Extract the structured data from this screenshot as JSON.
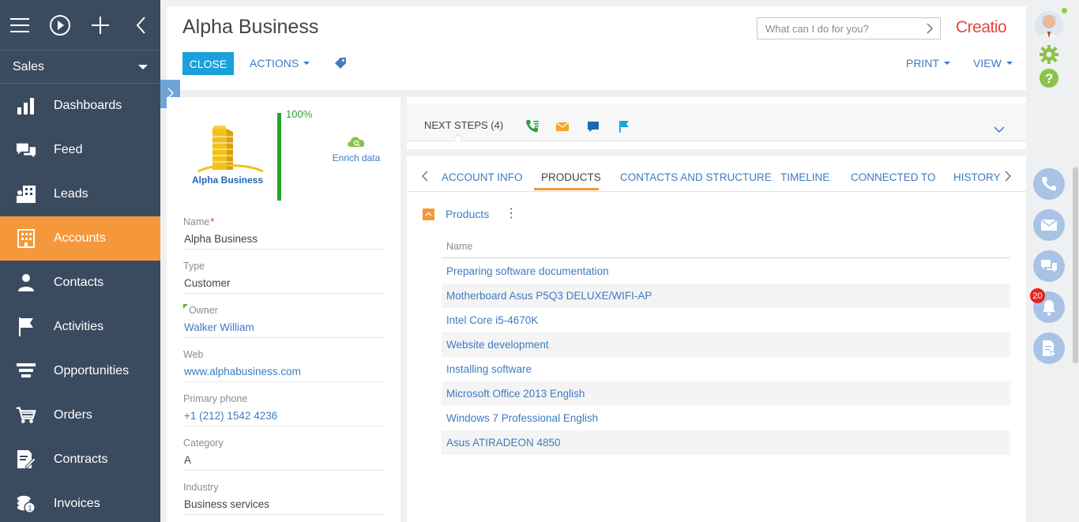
{
  "sidebar": {
    "workspace": "Sales",
    "items": [
      {
        "label": "Dashboards",
        "icon": "dashboards-icon"
      },
      {
        "label": "Feed",
        "icon": "feed-icon"
      },
      {
        "label": "Leads",
        "icon": "leads-icon"
      },
      {
        "label": "Accounts",
        "icon": "accounts-icon"
      },
      {
        "label": "Contacts",
        "icon": "contacts-icon"
      },
      {
        "label": "Activities",
        "icon": "activities-icon"
      },
      {
        "label": "Opportunities",
        "icon": "opportunities-icon"
      },
      {
        "label": "Orders",
        "icon": "orders-icon"
      },
      {
        "label": "Contracts",
        "icon": "contracts-icon"
      },
      {
        "label": "Invoices",
        "icon": "invoices-icon"
      }
    ],
    "active_item": "Accounts"
  },
  "header": {
    "title": "Alpha Business",
    "search_placeholder": "What can I do for you?",
    "logo": "Creatio",
    "close_label": "CLOSE",
    "actions_label": "ACTIONS",
    "print_label": "PRINT",
    "view_label": "VIEW"
  },
  "profile": {
    "company_logo_text": "Alpha Business",
    "completeness": "100%",
    "completeness_value": 1.0,
    "enrich_label": "Enrich data",
    "fields": [
      {
        "label": "Name",
        "value": "Alpha Business",
        "required": true
      },
      {
        "label": "Type",
        "value": "Customer"
      },
      {
        "label": "Owner",
        "value": "Walker William",
        "link": true
      },
      {
        "label": "Web",
        "value": "www.alphabusiness.com",
        "link": true
      },
      {
        "label": "Primary phone",
        "value": "+1 (212) 1542 4236",
        "link": true
      },
      {
        "label": "Category",
        "value": "A"
      },
      {
        "label": "Industry",
        "value": "Business services"
      }
    ]
  },
  "next_steps": {
    "title": "NEXT STEPS (4)"
  },
  "tabs": {
    "items": [
      "ACCOUNT INFO",
      "PRODUCTS",
      "CONTACTS AND STRUCTURE",
      "TIMELINE",
      "CONNECTED TO",
      "HISTORY"
    ],
    "active": "PRODUCTS"
  },
  "products": {
    "group_title": "Products",
    "column_header": "Name",
    "rows": [
      "Preparing software documentation",
      "Motherboard Asus P5Q3 DELUXE/WIFI-AP",
      "Intel Core i5-4670K",
      "Website development",
      "Installing software",
      "Microsoft Office 2013 English",
      "Windows 7 Professional English",
      "Asus ATIRADEON 4850"
    ]
  },
  "rail": {
    "notification_count": "20"
  },
  "colors": {
    "sidebar_bg": "#3b4b5f",
    "accent_orange": "#f5983b",
    "primary_blue": "#1ba0db",
    "link_blue": "#3f7bc0",
    "completeness_green": "#28a42b"
  }
}
